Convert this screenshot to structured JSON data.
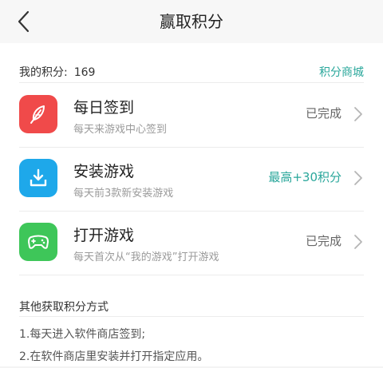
{
  "header": {
    "title": "赢取积分"
  },
  "points": {
    "label": "我的积分:",
    "value": "169",
    "store_link": "积分商城"
  },
  "tasks": [
    {
      "title": "每日签到",
      "subtitle": "每天来游戏中心签到",
      "status": "已完成",
      "icon": "feather-icon",
      "color": "#f04a4a"
    },
    {
      "title": "安装游戏",
      "subtitle": "每天前3款新安装游戏",
      "status": "最高+30积分",
      "icon": "download-icon",
      "color": "#1ea8ea"
    },
    {
      "title": "打开游戏",
      "subtitle": "每天首次从“我的游戏”打开游戏",
      "status": "已完成",
      "icon": "gamepad-icon",
      "color": "#3ec659"
    }
  ],
  "other": {
    "title": "其他获取积分方式",
    "items": [
      "1.每天进入软件商店签到;",
      "2.在软件商店里安装并打开指定应用。"
    ]
  }
}
